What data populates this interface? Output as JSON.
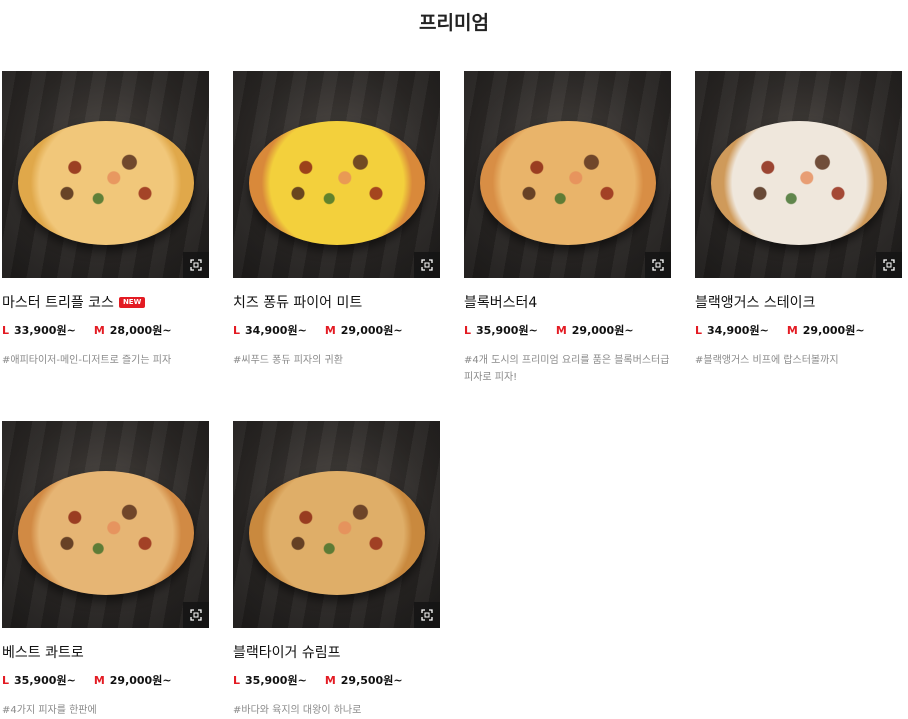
{
  "page": {
    "title": "프리미엄"
  },
  "labels": {
    "size_l": "L",
    "size_m": "M",
    "new_badge": "NEW"
  },
  "colors": {
    "accent": "#e31b23",
    "desc_text": "#8a8a8a"
  },
  "icons": {
    "zoom": "zoom-expand-icon"
  },
  "products": [
    {
      "name": "마스터 트리플 코스",
      "is_new": true,
      "price_l": "33,900원~",
      "price_m": "28,000원~",
      "desc": "#애피타이저-메인-디저트로 즐기는 피자",
      "crust": "#e0a84a",
      "cheese": "#f1c77a"
    },
    {
      "name": "치즈 퐁듀 파이어 미트",
      "is_new": false,
      "price_l": "34,900원~",
      "price_m": "29,000원~",
      "desc": "#씨푸드 퐁듀 피자의 귀환",
      "crust": "#d9893a",
      "cheese": "#f3d03c"
    },
    {
      "name": "블록버스터4",
      "is_new": false,
      "price_l": "35,900원~",
      "price_m": "29,000원~",
      "desc": "#4개 도시의 프리미엄 요리를 품은 블록버스터급 피자로 피자!",
      "crust": "#d88e45",
      "cheese": "#e9b46a"
    },
    {
      "name": "블랙앵거스 스테이크",
      "is_new": false,
      "price_l": "34,900원~",
      "price_m": "29,000원~",
      "desc": "#블랙앵거스 비프에 랍스터볼까지",
      "crust": "#cf9a5a",
      "cheese": "#efe7dc"
    },
    {
      "name": "베스트 콰트로",
      "is_new": false,
      "price_l": "35,900원~",
      "price_m": "29,000원~",
      "desc": "#4가지 피자를 한판에",
      "crust": "#d18a44",
      "cheese": "#e6b574"
    },
    {
      "name": "블랙타이거 슈림프",
      "is_new": false,
      "price_l": "35,900원~",
      "price_m": "29,500원~",
      "desc": "#바다와 육지의 대왕이 하나로",
      "crust": "#c9893e",
      "cheese": "#dfae68"
    }
  ]
}
